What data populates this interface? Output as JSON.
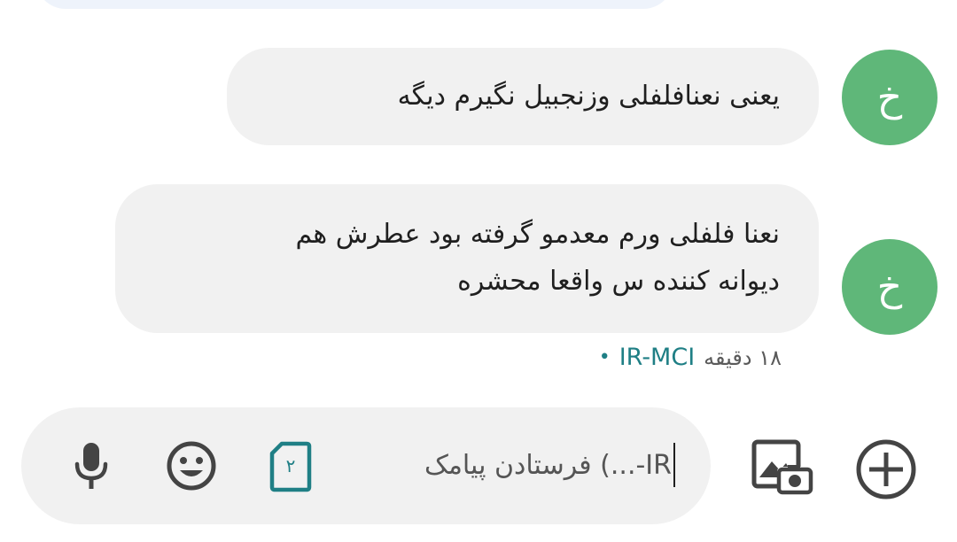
{
  "conversation": {
    "avatar_letter": "خ",
    "messages": [
      {
        "text": "یعنی نعنافلفلی وزنجبیل نگیرم دیگه"
      },
      {
        "line1": "نعنا فلفلی ورم معدمو گرفته بود عطرش هم",
        "line2": "دیوانه کننده س واقعا محشره"
      }
    ],
    "meta": {
      "carrier": "IR-MCI",
      "time": "۱۸ دقیقه",
      "separator": "•"
    }
  },
  "compose": {
    "placeholder": "فرستادن پیامک (...-IR",
    "sim_number": "۲"
  },
  "colors": {
    "avatar": "#5fb779",
    "bubble": "#f1f1f1",
    "accent_teal": "#1f7f85"
  },
  "icons": {
    "mic": "microphone-icon",
    "emoji": "emoji-icon",
    "sim": "sim-card-icon",
    "gallery": "gallery-camera-icon",
    "add": "add-circle-icon"
  }
}
